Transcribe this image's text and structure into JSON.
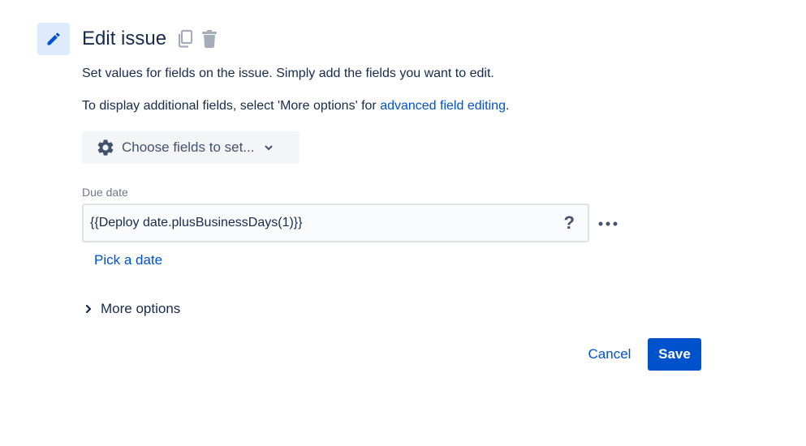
{
  "header": {
    "title": "Edit issue",
    "icons": {
      "main": "pencil-icon",
      "copy": "copy-icon",
      "delete": "trash-icon"
    }
  },
  "description": {
    "line1": "Set values for fields on the issue. Simply add the fields you want to edit.",
    "line2_prefix": "To display additional fields, select 'More options' for ",
    "line2_link": "advanced field editing",
    "line2_suffix": "."
  },
  "choose_fields": {
    "label": "Choose fields to set...",
    "icon": "gear-icon",
    "chevron": "chevron-down-icon"
  },
  "due_date": {
    "label": "Due date",
    "value": "{{Deploy date.plusBusinessDays(1)}}",
    "help_glyph": "?",
    "more_icon": "more-horizontal-icon",
    "pick_date_label": "Pick a date"
  },
  "more_options": {
    "label": "More options",
    "icon": "chevron-right-icon"
  },
  "actions": {
    "cancel_label": "Cancel",
    "save_label": "Save"
  },
  "colors": {
    "primary": "#0052cc",
    "text": "#172b4d",
    "subtle": "#42526e",
    "icon_bg": "#deebff",
    "button_bg": "#f4f5f7"
  }
}
